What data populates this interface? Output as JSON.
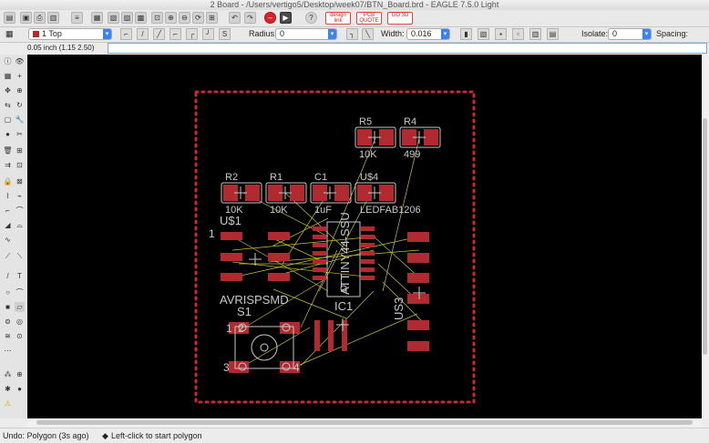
{
  "window": {
    "title": "2 Board - /Users/vertigo5/Desktop/week07/BTN_Board.brd - EAGLE 7.5.0 Light"
  },
  "toolbar": {
    "logos": [
      {
        "name": "design-link",
        "text": "design link"
      },
      {
        "name": "pcb-quote",
        "text": "PCB QUOTE"
      },
      {
        "name": "go-3d",
        "text": "GO 3D"
      }
    ]
  },
  "params": {
    "layer": "1 Top",
    "radius_label": "Radius:",
    "radius_value": "0",
    "width_label": "Width:",
    "width_value": "0.016",
    "isolate_label": "Isolate:",
    "isolate_value": "0",
    "spacing_label": "Spacing:"
  },
  "coord": "0.05 inch (1.15 2.50)",
  "status": {
    "undo": "Undo: Polygon (3s ago)",
    "hint": "Left-click to start polygon"
  },
  "board": {
    "labels": {
      "r5": "R5",
      "r5_val": "10K",
      "r4": "R4",
      "r4_val": "499",
      "r2": "R2",
      "r2_val": "10K",
      "r1": "R1",
      "r1_val": "10K",
      "c1": "C1",
      "c1_val": "1uF",
      "u4": "U$4",
      "u4_val": "LEDFAB1206",
      "u1": "U$1",
      "pin1": "1",
      "avr": "AVRISPSMD",
      "s1": "S1",
      "ic": "ATTINY44-SSU",
      "ic1": "IC1",
      "us3": "US3",
      "p1": "1",
      "p2": "2",
      "p3": "3",
      "p4": "4"
    }
  },
  "colors": {
    "pad": "#b02a30",
    "silk": "#c9c9c9",
    "airwire": "#c9c23a",
    "dimension": "#c82a30",
    "canvas": "#000000"
  }
}
